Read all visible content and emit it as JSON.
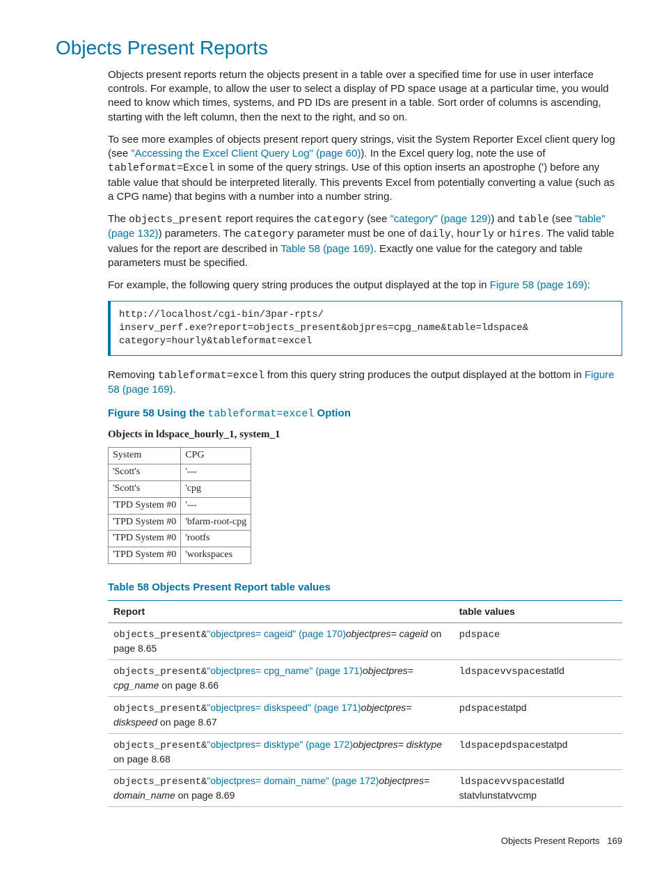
{
  "heading": "Objects Present Reports",
  "p1a": "Objects present reports return the objects present in a table over a specified time for use in user interface controls. For example, to allow the user to select a display of PD space usage at a particular time, you would need to know which times, systems, and PD IDs are present in a table. Sort order of columns is ascending, starting with the left column, then the next to the right, and so on.",
  "p2a": "To see more examples of objects present report query strings, visit the System Reporter Excel client query log (see ",
  "p2link": "\"Accessing the Excel Client Query Log\" (page 60)",
  "p2b": "). In the Excel query log, note the use of ",
  "p2code": "tableformat=Excel",
  "p2c": " in some of the query strings. Use of this option inserts an apostrophe (') before any table value that should be interpreted literally. This prevents Excel from potentially converting a value (such as a CPG name) that begins with a number into a number string.",
  "p3a": "The ",
  "p3code1": "objects_present",
  "p3b": " report requires the ",
  "p3code2": "category",
  "p3c": " (see ",
  "p3link1": "\"category\" (page 129)",
  "p3d": ") and ",
  "p3code3": "table",
  "p3e": " (see ",
  "p3link2": "\"table\" (page 132)",
  "p3f": ") parameters. The ",
  "p3code4": "category",
  "p3g": " parameter must be one of ",
  "p3code5": "daily",
  "p3h": ", ",
  "p3code6": "hourly",
  "p3i": " or ",
  "p3code7": "hires",
  "p3j": ". The valid table values for the report are described in ",
  "p3link3": "Table 58 (page 169)",
  "p3k": ". Exactly one value for the category and table parameters must be specified.",
  "p4a": "For example, the following query string produces the output displayed at the top in ",
  "p4link": "Figure 58 (page 169)",
  "p4b": ":",
  "codeblock": "http://localhost/cgi-bin/3par-rpts/\ninserv_perf.exe?report=objects_present&objpres=cpg_name&table=ldspace&\ncategory=hourly&tableformat=excel",
  "p5a": "Removing ",
  "p5code": "tableformat=excel",
  "p5b": " from this query string produces the output displayed at the bottom in ",
  "p5link": "Figure 58 (page 169)",
  "p5c": ".",
  "figTitleA": "Figure 58 Using the ",
  "figTitleCode": "tableformat=excel",
  "figTitleB": " Option",
  "subcaption": "Objects in ldspace_hourly_1, system_1",
  "example": {
    "headers": [
      "System",
      "CPG"
    ],
    "rows": [
      [
        "'Scott's",
        "'---"
      ],
      [
        "'Scott's",
        "'cpg"
      ],
      [
        "'TPD System #0",
        "'---"
      ],
      [
        "'TPD System #0",
        "'bfarm-root-cpg"
      ],
      [
        "'TPD System #0",
        "'rootfs"
      ],
      [
        "'TPD System #0",
        "'workspaces"
      ]
    ]
  },
  "table58Title": "Table 58 Objects Present Report table values",
  "table58": {
    "headers": [
      "Report",
      "table values"
    ],
    "rows": [
      {
        "prefix": "objects_present&",
        "link": "\"objectpres= cageid\" (page 170)",
        "italic": "objectpres= cageid",
        "suffix": " on page 8.65",
        "valuesMono": "pdspace",
        "valuesPlain": ""
      },
      {
        "prefix": "objects_present&",
        "link": "\"objectpres= cpg_name\" (page 171)",
        "italic": "objectpres= cpg_name",
        "suffix": " on page 8.66",
        "valuesMono": "ldspacevvspace",
        "valuesPlain": "statld"
      },
      {
        "prefix": "objects_present&",
        "link": "\"objectpres= diskspeed\" (page 171)",
        "italic": "objectpres= diskspeed",
        "suffix": " on page 8.67",
        "valuesMono": "pdspace",
        "valuesPlain": "statpd"
      },
      {
        "prefix": "objects_present&",
        "link": "\"objectpres= disktype\" (page 172)",
        "italic": "objectpres= disktype",
        "suffix": " on page 8.68",
        "valuesMono": "ldspacepdspace",
        "valuesPlain": "statpd"
      },
      {
        "prefix": "objects_present&",
        "link": "\"objectpres= domain_name\" (page 172)",
        "italic": "objectpres= domain_name",
        "suffix": " on page 8.69",
        "valuesMono": "ldspacevvspace",
        "valuesPlain": "statld statvlunstatvvcmp"
      }
    ]
  },
  "footerLabel": "Objects Present Reports",
  "footerPage": "169"
}
